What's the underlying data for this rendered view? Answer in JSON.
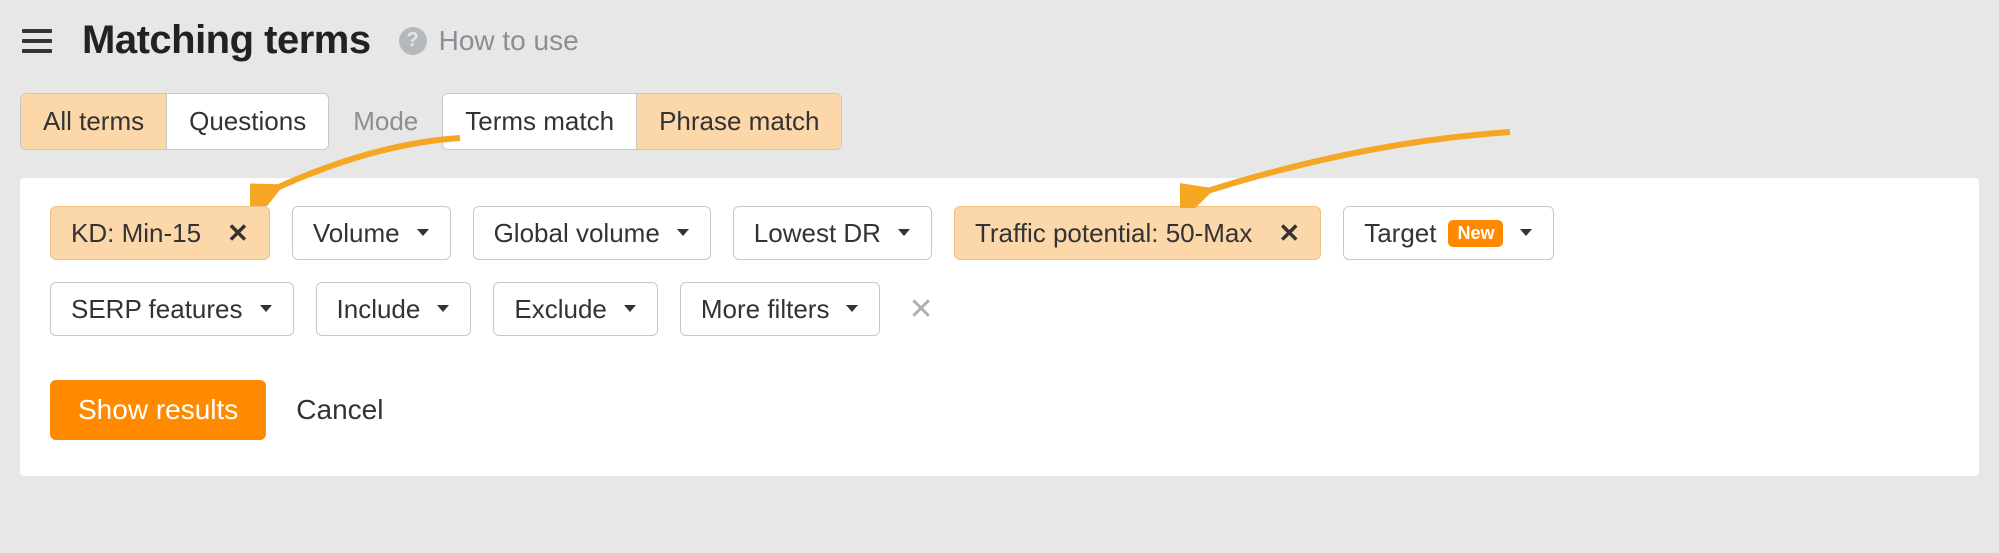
{
  "header": {
    "title": "Matching terms",
    "how_to_use": "How to use"
  },
  "tabs": {
    "all_terms": "All terms",
    "questions": "Questions"
  },
  "mode": {
    "label": "Mode",
    "terms_match": "Terms match",
    "phrase_match": "Phrase match"
  },
  "filters": {
    "kd": "KD: Min-15",
    "volume": "Volume",
    "global_volume": "Global volume",
    "lowest_dr": "Lowest DR",
    "traffic_potential": "Traffic potential: 50-Max",
    "target": "Target",
    "target_badge": "New",
    "serp_features": "SERP features",
    "include": "Include",
    "exclude": "Exclude",
    "more_filters": "More filters"
  },
  "actions": {
    "show_results": "Show results",
    "cancel": "Cancel"
  }
}
